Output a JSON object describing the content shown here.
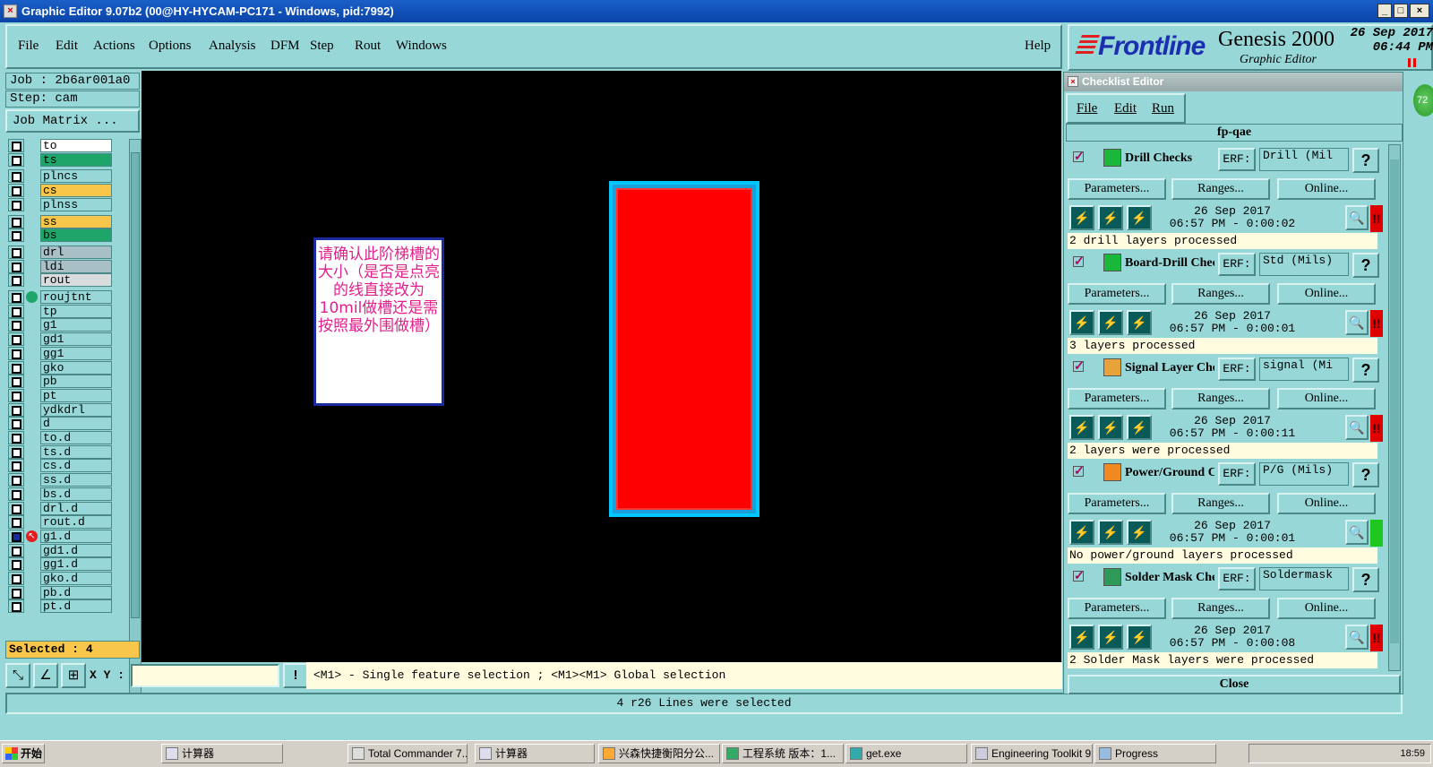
{
  "window": {
    "title": "Graphic Editor 9.07b2 (00@HY-HYCAM-PC171 - Windows, pid:7992)"
  },
  "menu": {
    "file": "File",
    "edit": "Edit",
    "actions": "Actions",
    "options": "Options",
    "analysis": "Analysis",
    "dfm": "DFM",
    "step": "Step",
    "rout": "Rout",
    "windows": "Windows",
    "help": "Help"
  },
  "brand": {
    "logo": "Frontline",
    "product": "Genesis 2000",
    "subtitle": "Graphic Editor",
    "date": "26 Sep 2017",
    "time": "06:44 PM"
  },
  "job": {
    "job_label": "Job : 2b6ar001a0",
    "step_label": "Step: cam",
    "matrix_button": "Job Matrix ..."
  },
  "layers": [
    {
      "name": "to",
      "color": "#ffffff"
    },
    {
      "name": "ts",
      "color": "#1ea66a"
    },
    {
      "name": "plncs",
      "color": "#98d7d8"
    },
    {
      "name": "cs",
      "color": "#f7c64a"
    },
    {
      "name": "plnss",
      "color": "#98d7d8"
    },
    {
      "name": "ss",
      "color": "#f7c64a"
    },
    {
      "name": "bs",
      "color": "#1ea66a"
    },
    {
      "name": "drl",
      "color": "#a9bfc6"
    },
    {
      "name": "ldi",
      "color": "#a9bfc6"
    },
    {
      "name": "rout",
      "color": "#d8dcdc"
    },
    {
      "name": "roujtnt",
      "color": "#98d7d8"
    },
    {
      "name": "tp",
      "color": "#98d7d8"
    },
    {
      "name": "g1",
      "color": "#98d7d8"
    },
    {
      "name": "gd1",
      "color": "#98d7d8"
    },
    {
      "name": "gg1",
      "color": "#98d7d8"
    },
    {
      "name": "gko",
      "color": "#98d7d8"
    },
    {
      "name": "pb",
      "color": "#98d7d8"
    },
    {
      "name": "pt",
      "color": "#98d7d8"
    },
    {
      "name": "ydkdrl",
      "color": "#98d7d8"
    },
    {
      "name": "d",
      "color": "#98d7d8"
    },
    {
      "name": "to.d",
      "color": "#98d7d8"
    },
    {
      "name": "ts.d",
      "color": "#98d7d8"
    },
    {
      "name": "cs.d",
      "color": "#98d7d8"
    },
    {
      "name": "ss.d",
      "color": "#98d7d8"
    },
    {
      "name": "bs.d",
      "color": "#98d7d8"
    },
    {
      "name": "drl.d",
      "color": "#98d7d8"
    },
    {
      "name": "rout.d",
      "color": "#98d7d8"
    },
    {
      "name": "g1.d",
      "color": "#98d7d8"
    },
    {
      "name": "gd1.d",
      "color": "#98d7d8"
    },
    {
      "name": "gg1.d",
      "color": "#98d7d8"
    },
    {
      "name": "gko.d",
      "color": "#98d7d8"
    },
    {
      "name": "pb.d",
      "color": "#98d7d8"
    },
    {
      "name": "pt.d",
      "color": "#98d7d8"
    }
  ],
  "selected": "Selected : 4",
  "canvas": {
    "note": "请确认此阶梯槽的大小（是否是点亮的线直接改为10mil做槽还是需按照最外围做槽）"
  },
  "coords": {
    "xy_label": "X Y :",
    "value": ""
  },
  "hint": "<M1> - Single feature selection ; <M1><M1> Global selection",
  "status": "4 r26 Lines were selected",
  "checklist": {
    "title": "Checklist Editor",
    "menu": {
      "file": "File",
      "edit": "Edit",
      "run": "Run"
    },
    "name": "fp-qae",
    "erf_label": "ERF:",
    "params_label": "Parameters...",
    "ranges_label": "Ranges...",
    "online_label": "Online...",
    "close_label": "Close",
    "checks": [
      {
        "name": "Drill Checks",
        "erf": "Drill (Mil",
        "date": "26 Sep 2017",
        "time": "06:57 PM - 0:00:02",
        "status": "!!",
        "status_color": "#e00000",
        "message": "2 drill layers processed",
        "icon_color": "#1ab83a"
      },
      {
        "name": "Board-Drill Checks",
        "erf": "Std (Mils)",
        "date": "26 Sep 2017",
        "time": "06:57 PM - 0:00:01",
        "status": "!!",
        "status_color": "#e00000",
        "message": "3 layers processed",
        "icon_color": "#1ab83a"
      },
      {
        "name": "Signal Layer Checks",
        "erf": "signal (Mi",
        "date": "26 Sep 2017",
        "time": "06:57 PM - 0:00:11",
        "status": "!!",
        "status_color": "#e00000",
        "message": "2 layers were processed",
        "icon_color": "#e8a23a"
      },
      {
        "name": "Power/Ground Checks",
        "erf": "P/G (Mils)",
        "date": "26 Sep 2017",
        "time": "06:57 PM - 0:00:01",
        "status": "",
        "status_color": "#1ec81e",
        "message": "No power/ground layers processed",
        "icon_color": "#f08a20"
      },
      {
        "name": "Solder Mask Checks",
        "erf": "Soldermask",
        "date": "26 Sep 2017",
        "time": "06:57 PM - 0:00:08",
        "status": "!!",
        "status_color": "#e00000",
        "message": "2 Solder Mask layers were processed",
        "icon_color": "#2e9a5a"
      }
    ]
  },
  "taskbar": {
    "start": "开始",
    "items": [
      "计算器",
      "Total Commander 7....",
      "计算器",
      "兴森快捷衡阳分公...",
      "工程系统  版本：1...",
      "get.exe",
      "Engineering Toolkit 9...",
      "Progress"
    ],
    "clock": "18:59"
  },
  "colors": {
    "panel": "#98d7d8",
    "canvas_bg": "#000000",
    "feature_fill": "#ff0000",
    "feature_outline": "#00c6ff"
  }
}
